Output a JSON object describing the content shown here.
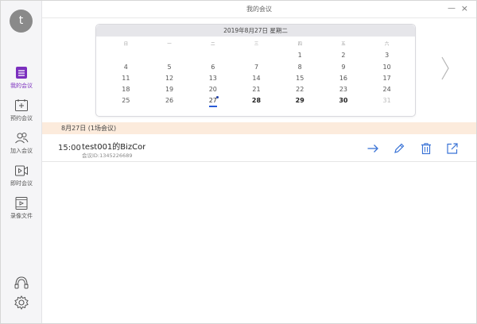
{
  "sidebar": {
    "avatar_letter": "t",
    "items": [
      {
        "label": "我的会议",
        "icon": "list-icon",
        "active": true
      },
      {
        "label": "预约会议",
        "icon": "calendar-add-icon",
        "active": false
      },
      {
        "label": "加入会议",
        "icon": "people-icon",
        "active": false
      },
      {
        "label": "即时会议",
        "icon": "video-icon",
        "active": false
      },
      {
        "label": "录像文件",
        "icon": "film-icon",
        "active": false
      }
    ],
    "bottom_icons": [
      "headset-icon",
      "gear-icon"
    ]
  },
  "titlebar": {
    "title": "我的会议",
    "minimize": "—",
    "close": "×"
  },
  "calendar": {
    "header": "2019年8月27日 星期二",
    "weekdays": [
      "日",
      "一",
      "二",
      "三",
      "四",
      "五",
      "六"
    ],
    "weeks": [
      [
        "",
        "",
        "",
        "",
        "1",
        "2",
        "3"
      ],
      [
        "4",
        "5",
        "6",
        "7",
        "8",
        "9",
        "10"
      ],
      [
        "11",
        "12",
        "13",
        "14",
        "15",
        "16",
        "17"
      ],
      [
        "18",
        "19",
        "20",
        "21",
        "22",
        "23",
        "24"
      ],
      [
        "25",
        "26",
        "27",
        "28",
        "29",
        "30",
        "31"
      ]
    ],
    "today": "27",
    "event_days": [
      "27"
    ],
    "bold_days": [
      "28",
      "29",
      "30"
    ],
    "muted_days": [
      "31"
    ],
    "accent_color": "#2a5bd7"
  },
  "day_section": {
    "header": "8月27日 (1场会议)"
  },
  "meetings": [
    {
      "time": "15:00",
      "title": "test001的BizCor",
      "id_text": "会议ID:1345226689",
      "actions": [
        "arrow-right-icon",
        "pencil-icon",
        "trash-icon",
        "share-icon"
      ]
    }
  ],
  "colors": {
    "active_nav": "#7b2fbe",
    "action_icon": "#3a73d6",
    "day_header_bg": "#fcebdc"
  }
}
